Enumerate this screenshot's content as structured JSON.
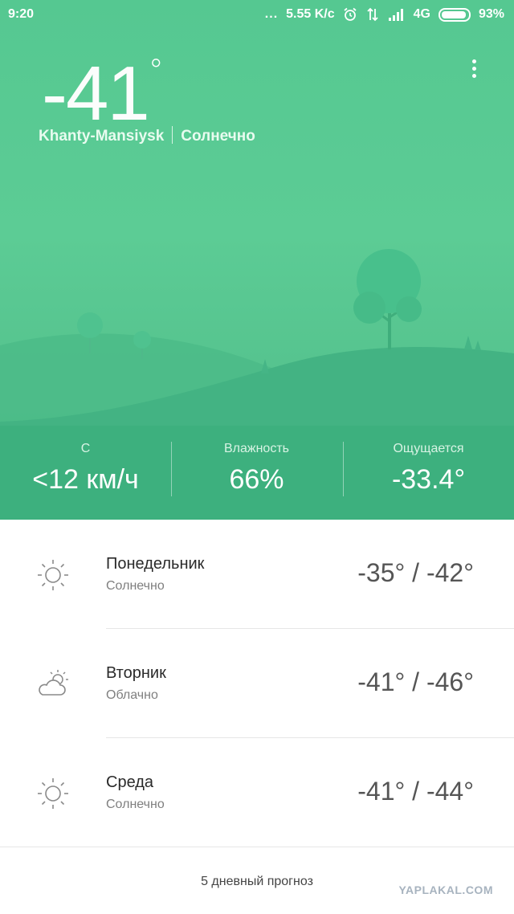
{
  "status_bar": {
    "time": "9:20",
    "dots": "...",
    "speed": "5.55 K/c",
    "network": "4G",
    "battery": "93%",
    "battery_level": 0.93
  },
  "current": {
    "temperature": "-41",
    "degree": "°",
    "city": "Khanty-Mansiysk",
    "condition": "Солнечно"
  },
  "metrics": {
    "wind": {
      "label": "С",
      "value": "<12 км/ч"
    },
    "humidity": {
      "label": "Влажность",
      "value": "66%"
    },
    "feels_like": {
      "label": "Ощущается",
      "value": "-33.4°"
    }
  },
  "forecast": [
    {
      "day": "Понедельник",
      "condition": "Солнечно",
      "range": "-35° / -42°",
      "icon": "sun-icon"
    },
    {
      "day": "Вторник",
      "condition": "Облачно",
      "range": "-41° / -46°",
      "icon": "cloud-sun-icon"
    },
    {
      "day": "Среда",
      "condition": "Солнечно",
      "range": "-41° / -44°",
      "icon": "sun-icon"
    }
  ],
  "footer": {
    "five_day_label": "5 дневный прогноз",
    "watermark": "YAPLAKAL.COM"
  },
  "colors": {
    "hero_top": "#55c891",
    "hero_bottom": "#3fb17f",
    "hill_front": "#3eaf7e",
    "hill_back": "#4dbb88",
    "tree": "#47c08d"
  }
}
